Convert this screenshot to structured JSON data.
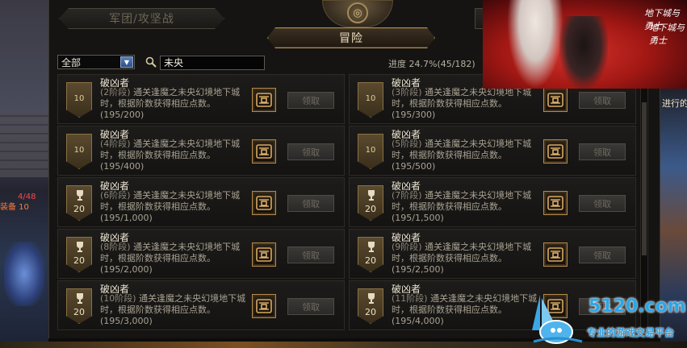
{
  "hud": {
    "left_line1": "4/48",
    "left_line2": "装备 10",
    "right_text": "进行的"
  },
  "tabs": {
    "guild_siege": "军团/攻坚战",
    "adventure": "冒险"
  },
  "filter": {
    "category_selected": "全部",
    "search_value": "未央"
  },
  "progress": {
    "label": "进度 24.7%(45/182)",
    "percent": 24.7,
    "done": 45,
    "total": 182
  },
  "achievements": [
    {
      "name": "破凶者",
      "level": "10",
      "icon": "shield",
      "stage": "(2阶段)",
      "desc": "通关逢魔之未央幻境地下城时，根据阶数获得相应点数。",
      "count": "(195/200)",
      "button": "领取"
    },
    {
      "name": "破凶者",
      "level": "10",
      "icon": "shield",
      "stage": "(3阶段)",
      "desc": "通关逢魔之未央幻境地下城时，根据阶数获得相应点数。",
      "count": "(195/300)",
      "button": "领取"
    },
    {
      "name": "破凶者",
      "level": "10",
      "icon": "shield",
      "stage": "(4阶段)",
      "desc": "通关逢魔之未央幻境地下城时，根据阶数获得相应点数。",
      "count": "(195/400)",
      "button": "领取"
    },
    {
      "name": "破凶者",
      "level": "10",
      "icon": "shield",
      "stage": "(5阶段)",
      "desc": "通关逢魔之未央幻境地下城时，根据阶数获得相应点数。",
      "count": "(195/500)",
      "button": "领取"
    },
    {
      "name": "破凶者",
      "level": "20",
      "icon": "trophy",
      "stage": "(6阶段)",
      "desc": "通关逢魔之未央幻境地下城时，根据阶数获得相应点数。",
      "count": "(195/1,000)",
      "button": "领取"
    },
    {
      "name": "破凶者",
      "level": "20",
      "icon": "trophy",
      "stage": "(7阶段)",
      "desc": "通关逢魔之未央幻境地下城时，根据阶数获得相应点数。",
      "count": "(195/1,500)",
      "button": "领取"
    },
    {
      "name": "破凶者",
      "level": "20",
      "icon": "trophy",
      "stage": "(8阶段)",
      "desc": "通关逢魔之未央幻境地下城时，根据阶数获得相应点数。",
      "count": "(195/2,000)",
      "button": "领取"
    },
    {
      "name": "破凶者",
      "level": "20",
      "icon": "trophy",
      "stage": "(9阶段)",
      "desc": "通关逢魔之未央幻境地下城时，根据阶数获得相应点数。",
      "count": "(195/2,500)",
      "button": "领取"
    },
    {
      "name": "破凶者",
      "level": "20",
      "icon": "trophy",
      "stage": "(10阶段)",
      "desc": "通关逢魔之未央幻境地下城时，根据阶数获得相应点数。",
      "count": "(195/3,000)",
      "button": "领取"
    },
    {
      "name": "破凶者",
      "level": "20",
      "icon": "trophy",
      "stage": "(11阶段)",
      "desc": "通关逢魔之未央幻境地下城时，根据阶数获得相应点数。",
      "count": "(195/4,000)",
      "button": "领取"
    }
  ],
  "ad": {
    "line1": "地下城与勇士",
    "line2": "地下城与勇士"
  },
  "watermark": {
    "site": "5120.com",
    "slogan": "专业的游戏交易平台"
  },
  "colors": {
    "accent_gold": "#b08f58",
    "panel_bg": "#151413",
    "watermark_blue": "#2aa7e6"
  }
}
